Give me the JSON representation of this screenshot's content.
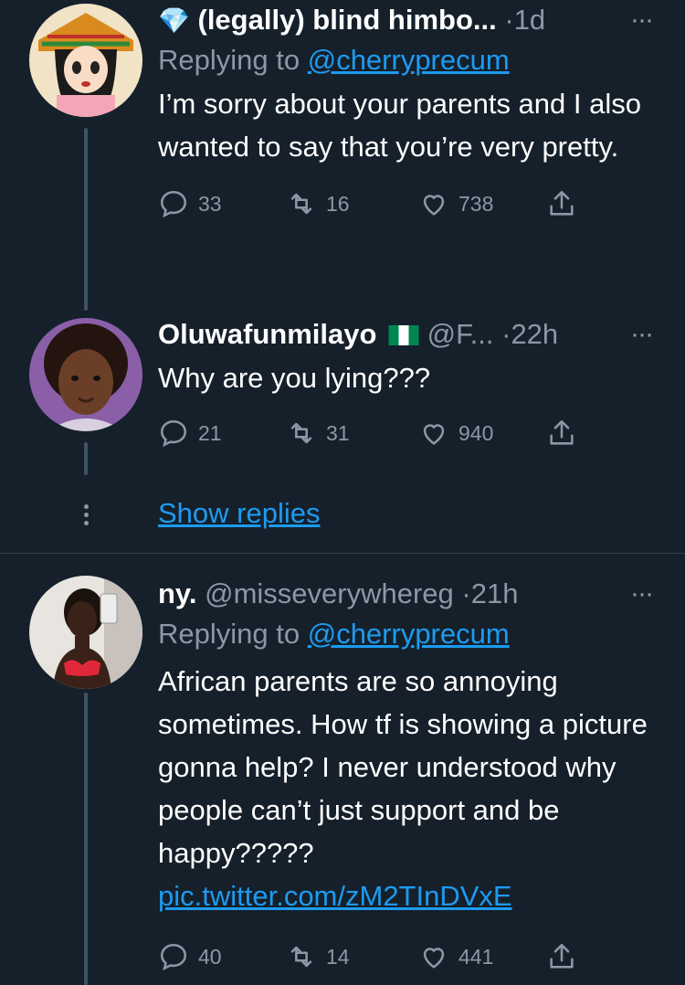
{
  "tweets": [
    {
      "name": "(legally) blind himbo...",
      "verified_emoji": "💎",
      "handle": "",
      "dot": "·",
      "time": "1d",
      "replying_prefix": "Replying to",
      "replying_to": "@cherryprecum",
      "text": "I’m sorry about your parents and I also wanted to say that you’re very pretty.",
      "replies": "33",
      "retweets": "16",
      "likes": "738"
    },
    {
      "name": "Oluwafunmilayo",
      "flag": "nigeria-flag",
      "handle": "@F...",
      "dot": "·",
      "time": "22h",
      "text": "Why are you lying???",
      "replies": "21",
      "retweets": "31",
      "likes": "940"
    },
    {
      "name": "ny.",
      "handle": "@misseverywhereg",
      "dot": "·",
      "time": "21h",
      "replying_prefix": "Replying to",
      "replying_to": "@cherryprecum",
      "text": "African parents are so annoying sometimes. How tf is showing a picture gonna help? I never understood why people can’t just support and be happy?????",
      "link": "pic.twitter.com/zM2TInDVxE",
      "replies": "40",
      "retweets": "14",
      "likes": "441"
    }
  ],
  "show_replies_label": "Show replies",
  "more_label": "···",
  "colors": {
    "background": "#15202b",
    "accent": "#1d9bf0",
    "muted": "#8b98a5",
    "divider": "#38444d"
  }
}
